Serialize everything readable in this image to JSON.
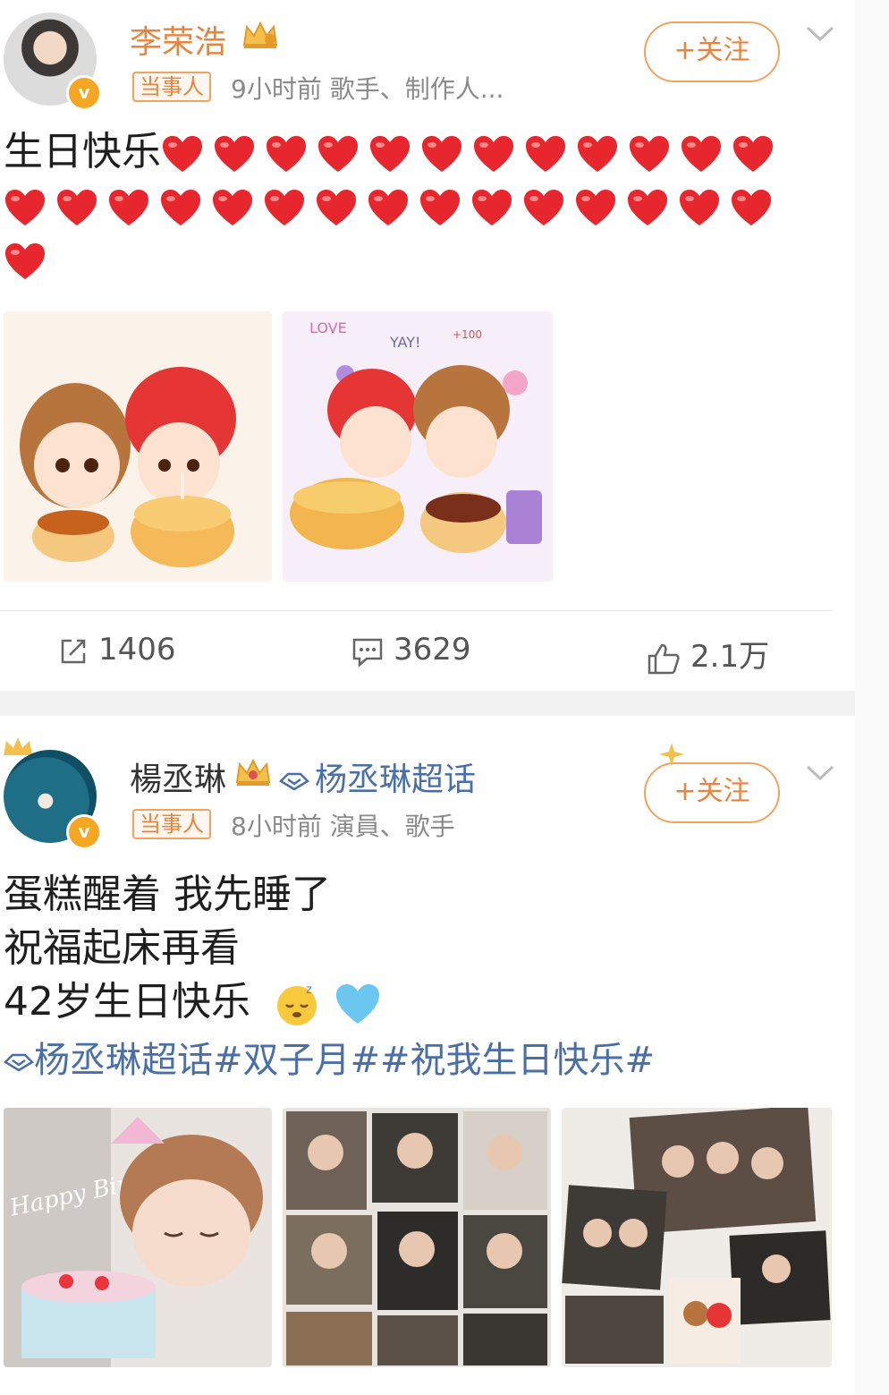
{
  "post1": {
    "author": "李荣浩",
    "tag": "当事人",
    "meta": "9小时前  歌手、制作人...",
    "follow_label": "+关注",
    "text_prefix": "生日快乐",
    "heart_count": 28,
    "stats": {
      "reposts": "1406",
      "comments": "3629",
      "likes": "2.1万"
    }
  },
  "post2": {
    "author": "楊丞琳",
    "topic_link": "杨丞琳超话",
    "tag": "当事人",
    "meta": "8小时前  演員、歌手",
    "follow_label": "+关注",
    "lines": [
      "蛋糕醒着 我先睡了",
      "祝福起床再看",
      "42岁生日快乐"
    ],
    "hashtags": "杨丞琳超话#双子月##祝我生日快乐#"
  },
  "images": {
    "img1_caption": "",
    "birthday_text": "Happy Birthday",
    "doodle_words": [
      "LOVE",
      "YAY!",
      "+100"
    ]
  },
  "colors": {
    "orange": "#e9843c",
    "link_blue": "#4a6fa8",
    "heart_red": "#e8262e",
    "gray": "#8a8a8a"
  },
  "icons": [
    "verified-badge-icon",
    "crown-icon",
    "chevron-down-icon",
    "repost-icon",
    "comment-icon",
    "like-icon",
    "supertopic-icon",
    "sleepy-emoji-icon",
    "blue-heart-icon"
  ]
}
